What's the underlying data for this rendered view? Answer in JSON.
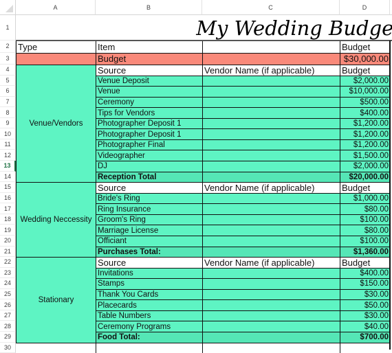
{
  "columns": [
    "A",
    "B",
    "C",
    "D"
  ],
  "selected_row": 13,
  "title": "My Wedding Budget",
  "header_row": {
    "type": "Type",
    "item": "Item",
    "vendor": "",
    "budget": "Budget"
  },
  "budget_row": {
    "label": "Budget",
    "amount": "$30,000.00"
  },
  "sections": [
    {
      "type": "Venue/Vendors",
      "source_label": "Source",
      "vendor_label": "Vendor Name (if applicable)",
      "budget_label": "Budget",
      "items": [
        {
          "name": "Venue Deposit",
          "amount": "$2,000.00"
        },
        {
          "name": "Venue",
          "amount": "$10,000.00"
        },
        {
          "name": "Ceremony",
          "amount": "$500.00"
        },
        {
          "name": "Tips for Vendors",
          "amount": "$400.00"
        },
        {
          "name": "Photographer Deposit 1",
          "amount": "$1,200.00"
        },
        {
          "name": "Photographer Deposit 1",
          "amount": "$1,200.00"
        },
        {
          "name": "Photographer Final",
          "amount": "$1,200.00"
        },
        {
          "name": "Videographer",
          "amount": "$1,500.00"
        },
        {
          "name": "DJ",
          "amount": "$2,000.00"
        }
      ],
      "total_label": "Reception Total",
      "total": "$20,000.00"
    },
    {
      "type": "Wedding Neccessity",
      "source_label": "Source",
      "vendor_label": "Vendor Name (if applicable)",
      "budget_label": "Budget",
      "items": [
        {
          "name": "Bride's Ring",
          "amount": "$1,000.00"
        },
        {
          "name": "Ring Insurance",
          "amount": "$80.00"
        },
        {
          "name": "Groom's Ring",
          "amount": "$100.00"
        },
        {
          "name": "Marriage License",
          "amount": "$80.00"
        },
        {
          "name": "Officiant",
          "amount": "$100.00"
        }
      ],
      "total_label": "Purchases Total:",
      "total": "$1,360.00"
    },
    {
      "type": "Stationary",
      "source_label": "Source",
      "vendor_label": "Vendor Name (if applicable)",
      "budget_label": "Budget",
      "items": [
        {
          "name": "Invitations",
          "amount": "$400.00"
        },
        {
          "name": "Stamps",
          "amount": "$150.00"
        },
        {
          "name": "Thank You Cards",
          "amount": "$30.00"
        },
        {
          "name": "Placecards",
          "amount": "$50.00"
        },
        {
          "name": "Table Numbers",
          "amount": "$30.00"
        },
        {
          "name": "Ceremony Programs",
          "amount": "$40.00"
        }
      ],
      "total_label": "Food Total:",
      "total": "$700.00"
    }
  ]
}
